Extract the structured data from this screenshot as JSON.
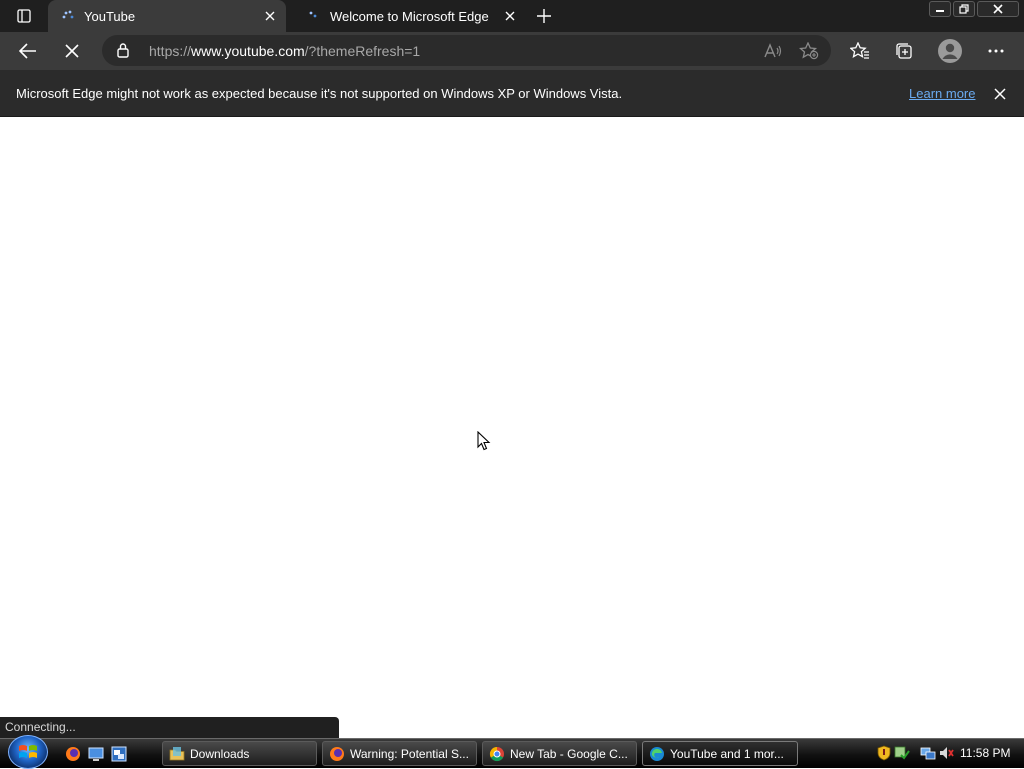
{
  "tabs": [
    {
      "title": "YouTube",
      "active": true
    },
    {
      "title": "Welcome to Microsoft Edge",
      "active": false
    }
  ],
  "address": {
    "scheme": "https://",
    "host": "www.youtube.com",
    "path": "/?themeRefresh=1"
  },
  "infobar": {
    "message": "Microsoft Edge might not work as expected because it's not supported on Windows XP or Windows Vista.",
    "link": "Learn more"
  },
  "status_text": "Connecting...",
  "taskbar": {
    "buttons": [
      {
        "label": "Downloads",
        "icon": "folder-icon"
      },
      {
        "label": "Warning: Potential S...",
        "icon": "firefox-icon"
      },
      {
        "label": "New Tab - Google C...",
        "icon": "chrome-icon"
      },
      {
        "label": "YouTube and 1 mor...",
        "icon": "edge-icon",
        "active": true
      }
    ],
    "clock": "11:58 PM"
  },
  "colors": {
    "tab_strip": "#1f1f1f",
    "toolbar": "#3b3b3b",
    "infobar": "#2b2b2b",
    "link": "#6aaaf0"
  }
}
